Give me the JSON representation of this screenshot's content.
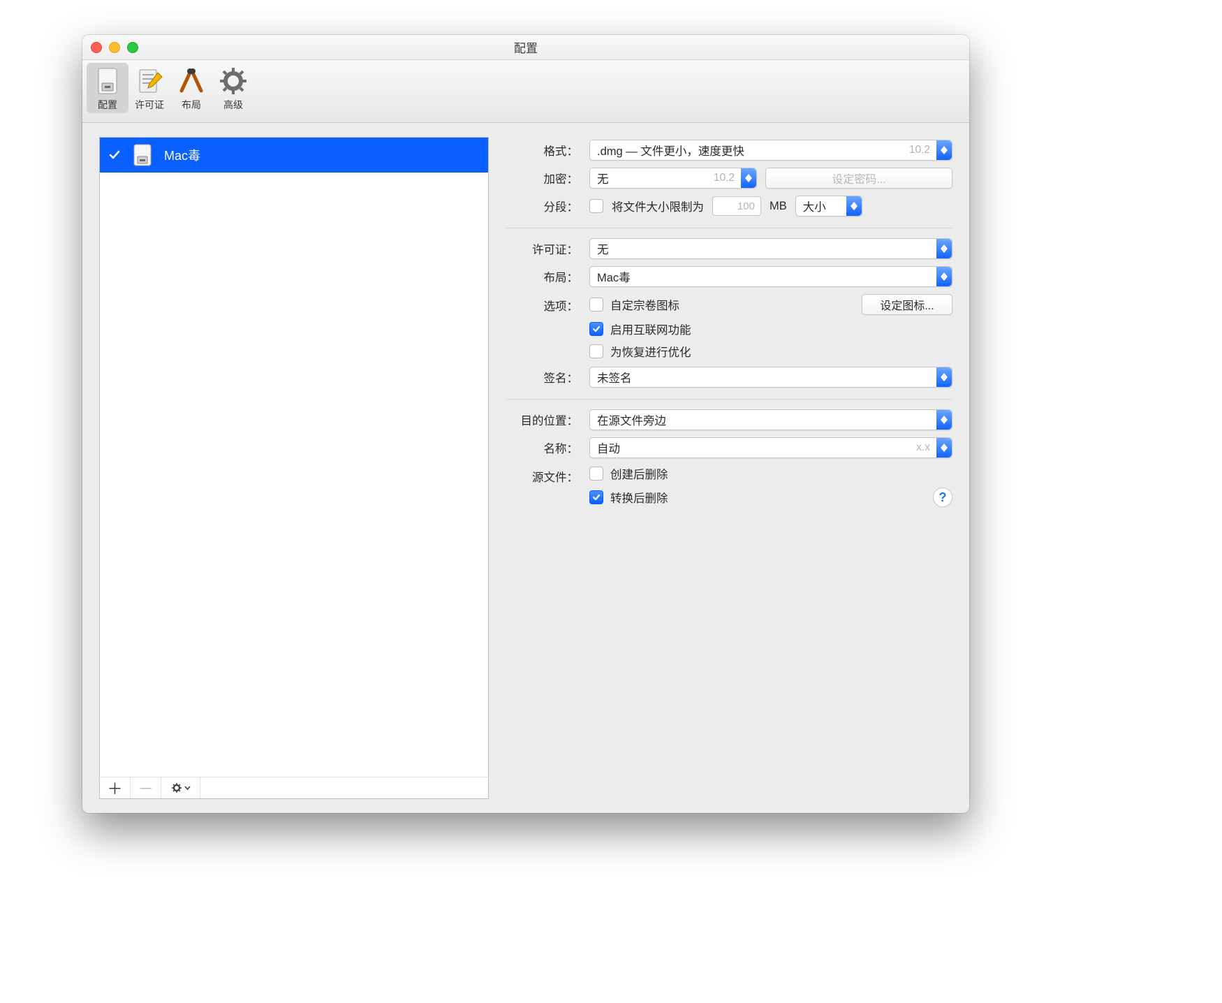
{
  "window": {
    "title": "配置"
  },
  "toolbar": [
    {
      "name": "tab-config",
      "label": "配置",
      "selected": true
    },
    {
      "name": "tab-license",
      "label": "许可证",
      "selected": false
    },
    {
      "name": "tab-layout",
      "label": "布局",
      "selected": false
    },
    {
      "name": "tab-advanced",
      "label": "高级",
      "selected": false
    }
  ],
  "list": {
    "items": [
      {
        "checked": true,
        "label": "Mac毒"
      }
    ]
  },
  "footer": {
    "add": "＋",
    "remove": "－",
    "gear": "⚙︎"
  },
  "form": {
    "format": {
      "label": "格式：",
      "value": ".dmg — 文件更小，速度更快",
      "extra": "10.2"
    },
    "encrypt": {
      "label": "加密：",
      "value": "无",
      "extra": "10.2",
      "setpw": "设定密码..."
    },
    "segment": {
      "label": "分段：",
      "cb_label": "将文件大小限制为",
      "field_ph": "100",
      "unit": "MB",
      "size": "大小"
    },
    "license": {
      "label": "许可证：",
      "value": "无"
    },
    "layout": {
      "label": "布局：",
      "value": "Mac毒"
    },
    "options": {
      "label": "选项：",
      "o1": "自定宗卷图标",
      "o2": "启用互联网功能",
      "o3": "为恢复进行优化",
      "seticon": "设定图标..."
    },
    "sign": {
      "label": "签名：",
      "value": "未签名"
    },
    "dest": {
      "label": "目的位置：",
      "value": "在源文件旁边"
    },
    "name": {
      "label": "名称：",
      "value": "自动",
      "extra": "x.x"
    },
    "source": {
      "label": "源文件：",
      "s1": "创建后删除",
      "s2": "转换后删除"
    }
  }
}
